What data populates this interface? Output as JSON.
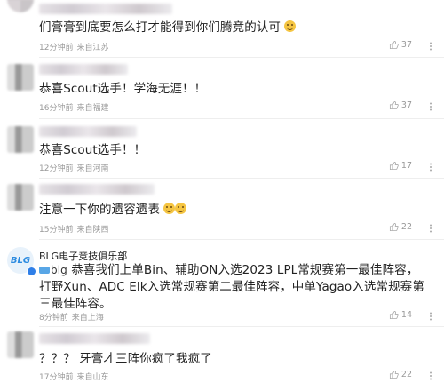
{
  "comments": [
    {
      "text": "们膏膏到底要怎么打才能得到你们腾竞的认可",
      "time": "12分钟前",
      "location": "来自江苏",
      "likes": "37"
    },
    {
      "text": "恭喜Scout选手！学海无涯！！",
      "time": "16分钟前",
      "location": "来自福建",
      "likes": "37"
    },
    {
      "text": "恭喜Scout选手！！",
      "time": "12分钟前",
      "location": "来自河南",
      "likes": "17"
    },
    {
      "text": "注意一下你的遗容遗表",
      "time": "15分钟前",
      "location": "来自陕西",
      "likes": "22"
    },
    {
      "author": "BLG电子竞技俱乐部",
      "logo": "BLG",
      "prefix": "blg",
      "text": "恭喜我们上单Bin、辅助ON入选2023 LPL常规赛第一最佳阵容，打野Xun、ADC Elk入选常规赛第二最佳阵容，中单Yagao入选常规赛第三最佳阵容。",
      "time": "8分钟前",
      "location": "来自上海",
      "likes": "14"
    },
    {
      "text": "？？？ 牙膏才三阵你疯了我疯了",
      "time": "17分钟前",
      "location": "来自山东",
      "likes": "22"
    }
  ],
  "icons": {
    "like": "thumbs-up-icon",
    "more": "more-dots-icon",
    "emoji": "smile-emoji-icon",
    "verified": "verified-badge-icon"
  },
  "colors": {
    "meta": "#999999",
    "text": "#222222",
    "brand_blue": "#2c8be0"
  }
}
